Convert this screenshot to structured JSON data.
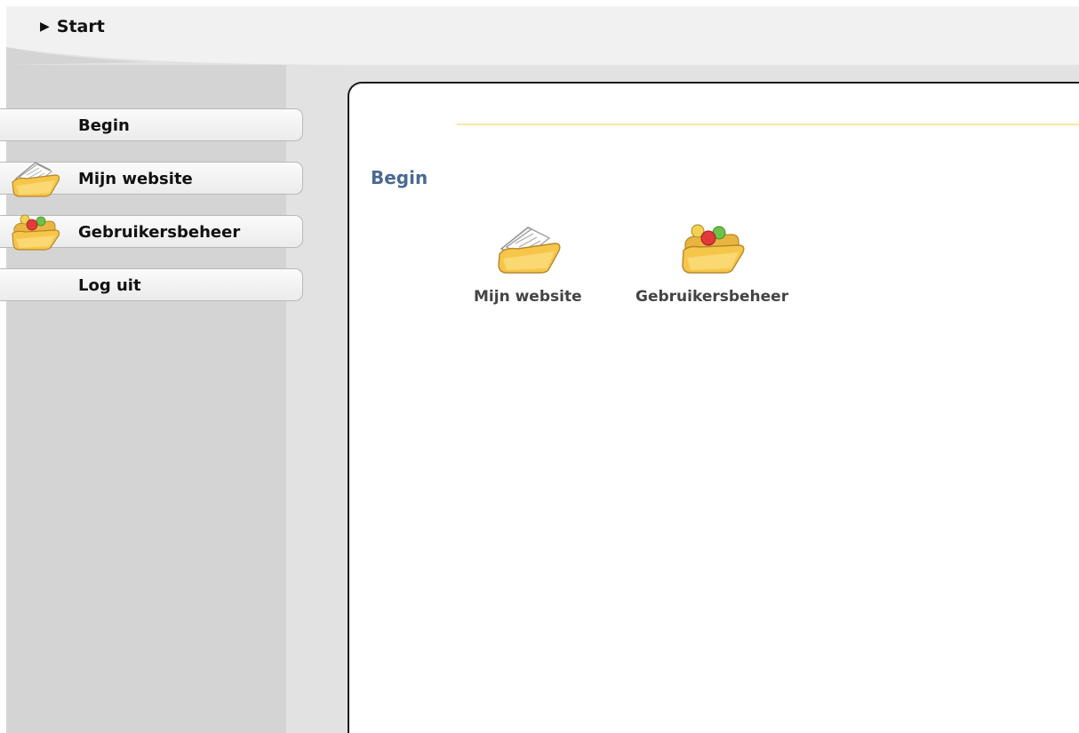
{
  "header": {
    "breadcrumb": "Start",
    "breadcrumb_marker": "▶"
  },
  "sidebar": {
    "items": [
      {
        "label": "Begin",
        "icon": "none"
      },
      {
        "label": "Mijn website",
        "icon": "folder-documents-icon"
      },
      {
        "label": "Gebruikersbeheer",
        "icon": "folder-users-icon"
      },
      {
        "label": "Log uit",
        "icon": "none"
      }
    ]
  },
  "main": {
    "title": "Begin",
    "tiles": [
      {
        "label": "Mijn website",
        "icon": "folder-documents-icon"
      },
      {
        "label": "Gebruikersbeheer",
        "icon": "folder-users-icon"
      }
    ]
  },
  "colors": {
    "title": "#4a6a8f",
    "accent_line": "#fbe7a3",
    "sidebar_bg": "#d4d4d4",
    "header_bg": "#f1f1f1"
  }
}
